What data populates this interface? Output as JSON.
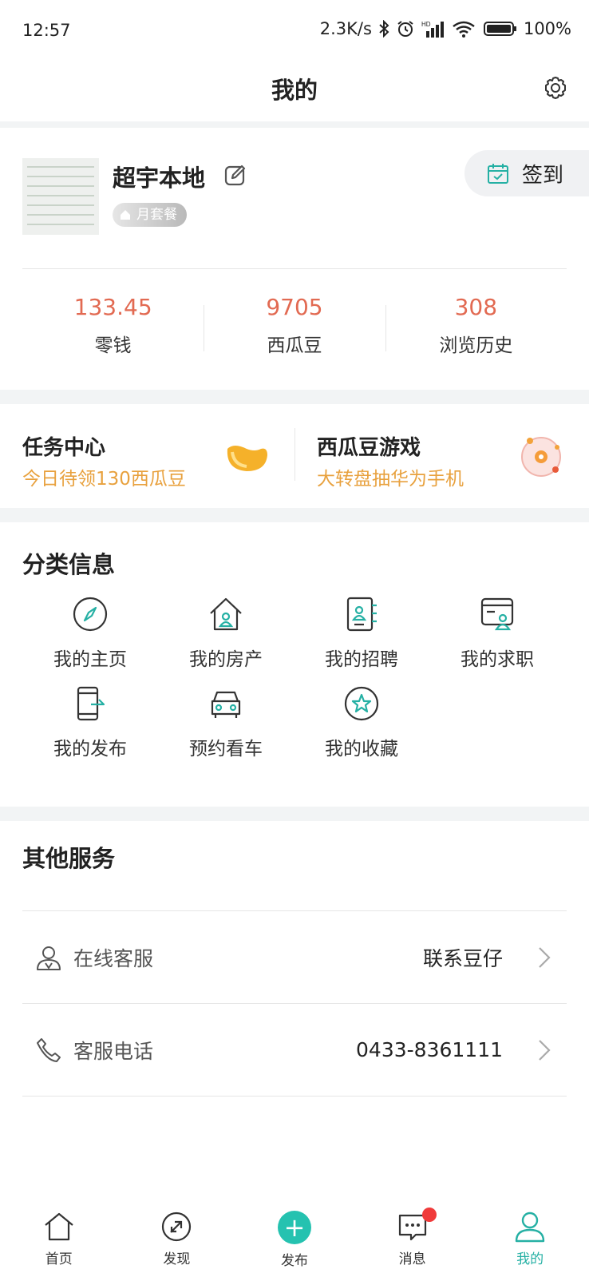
{
  "status_bar": {
    "time": "12:57",
    "speed": "2.3K/s",
    "battery": "100%"
  },
  "header": {
    "title": "我的"
  },
  "profile": {
    "name": "超宇本地",
    "plan_badge": "月套餐",
    "checkin_label": "签到",
    "stats": [
      {
        "value": "133.45",
        "label": "零钱"
      },
      {
        "value": "9705",
        "label": "西瓜豆"
      },
      {
        "value": "308",
        "label": "浏览历史"
      }
    ]
  },
  "tasks": [
    {
      "title": "任务中心",
      "subtitle": "今日待领130西瓜豆"
    },
    {
      "title": "西瓜豆游戏",
      "subtitle": "大转盘抽华为手机"
    }
  ],
  "categories": {
    "title": "分类信息",
    "items": [
      {
        "label": "我的主页",
        "icon": "compass-icon"
      },
      {
        "label": "我的房产",
        "icon": "house-icon"
      },
      {
        "label": "我的招聘",
        "icon": "id-card-icon"
      },
      {
        "label": "我的求职",
        "icon": "resume-icon"
      },
      {
        "label": "我的发布",
        "icon": "phone-share-icon"
      },
      {
        "label": "预约看车",
        "icon": "car-icon"
      },
      {
        "label": "我的收藏",
        "icon": "star-icon"
      }
    ]
  },
  "services": {
    "title": "其他服务",
    "items": [
      {
        "label": "在线客服",
        "value": "联系豆仔",
        "icon": "agent-icon"
      },
      {
        "label": "客服电话",
        "value": "0433-8361111",
        "icon": "phone-icon"
      }
    ]
  },
  "tabbar": {
    "items": [
      {
        "label": "首页",
        "icon": "home-icon"
      },
      {
        "label": "发现",
        "icon": "discover-icon"
      },
      {
        "label": "发布",
        "icon": "plus-icon"
      },
      {
        "label": "消息",
        "icon": "message-icon"
      },
      {
        "label": "我的",
        "icon": "user-icon",
        "active": true
      }
    ]
  },
  "colors": {
    "accent": "#25b0a4",
    "stat_value": "#e26a52",
    "task_sub": "#e8a13e",
    "badge_dot": "#f03a3a"
  }
}
